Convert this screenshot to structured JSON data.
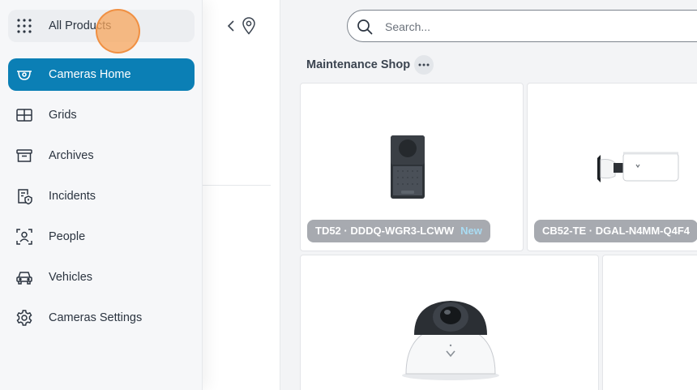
{
  "sidebar": {
    "items": [
      {
        "label": "All Products",
        "icon": "grid-dots-icon"
      },
      {
        "label": "Cameras Home",
        "icon": "dome-camera-icon"
      },
      {
        "label": "Grids",
        "icon": "grid-layout-icon"
      },
      {
        "label": "Archives",
        "icon": "archive-box-icon"
      },
      {
        "label": "Incidents",
        "icon": "incident-icon"
      },
      {
        "label": "People",
        "icon": "person-scan-icon"
      },
      {
        "label": "Vehicles",
        "icon": "car-icon"
      },
      {
        "label": "Cameras Settings",
        "icon": "gear-icon"
      }
    ]
  },
  "search": {
    "placeholder": "Search..."
  },
  "main": {
    "section_title": "Maintenance Shop",
    "cards": [
      {
        "name": "TD52 · DDDQ-WGR3-LCWW",
        "badge": "New"
      },
      {
        "name": "CB52-TE · DGAL-N4MM-Q4F4",
        "badge": ""
      },
      {
        "name": "",
        "badge": ""
      },
      {
        "name": "",
        "badge": ""
      }
    ]
  },
  "colors": {
    "accent": "#0b7fb5",
    "label_bg": "#a7aab0",
    "new_badge": "#a9dcf3"
  }
}
